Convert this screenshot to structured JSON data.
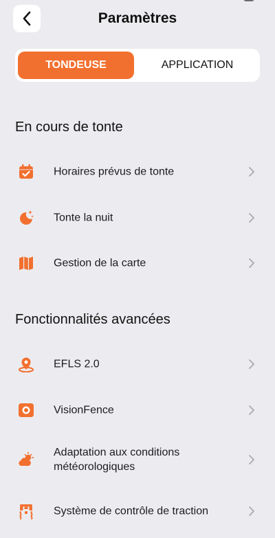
{
  "header": {
    "title": "Paramètres",
    "back_icon": "chevron-left-icon"
  },
  "tabs": [
    {
      "label": "TONDEUSE",
      "active": true
    },
    {
      "label": "APPLICATION",
      "active": false
    }
  ],
  "sections": [
    {
      "title": "En cours de tonte",
      "items": [
        {
          "label": "Horaires prévus de tonte",
          "icon": "calendar-check-icon"
        },
        {
          "label": "Tonte la nuit",
          "icon": "moon-stars-icon"
        },
        {
          "label": "Gestion de la carte",
          "icon": "map-icon"
        }
      ]
    },
    {
      "title": "Fonctionnalités avancées",
      "items": [
        {
          "label": "EFLS 2.0",
          "icon": "location-pin-icon"
        },
        {
          "label": "VisionFence",
          "icon": "camera-lens-icon"
        },
        {
          "label": "Adaptation aux conditions météorologiques",
          "icon": "weather-sun-cloud-icon"
        },
        {
          "label": "Système de contrôle de traction",
          "icon": "traction-wheels-icon"
        }
      ]
    }
  ],
  "colors": {
    "accent": "#F2702F",
    "background": "#ECECF0",
    "chevron": "#A9A9AE"
  }
}
